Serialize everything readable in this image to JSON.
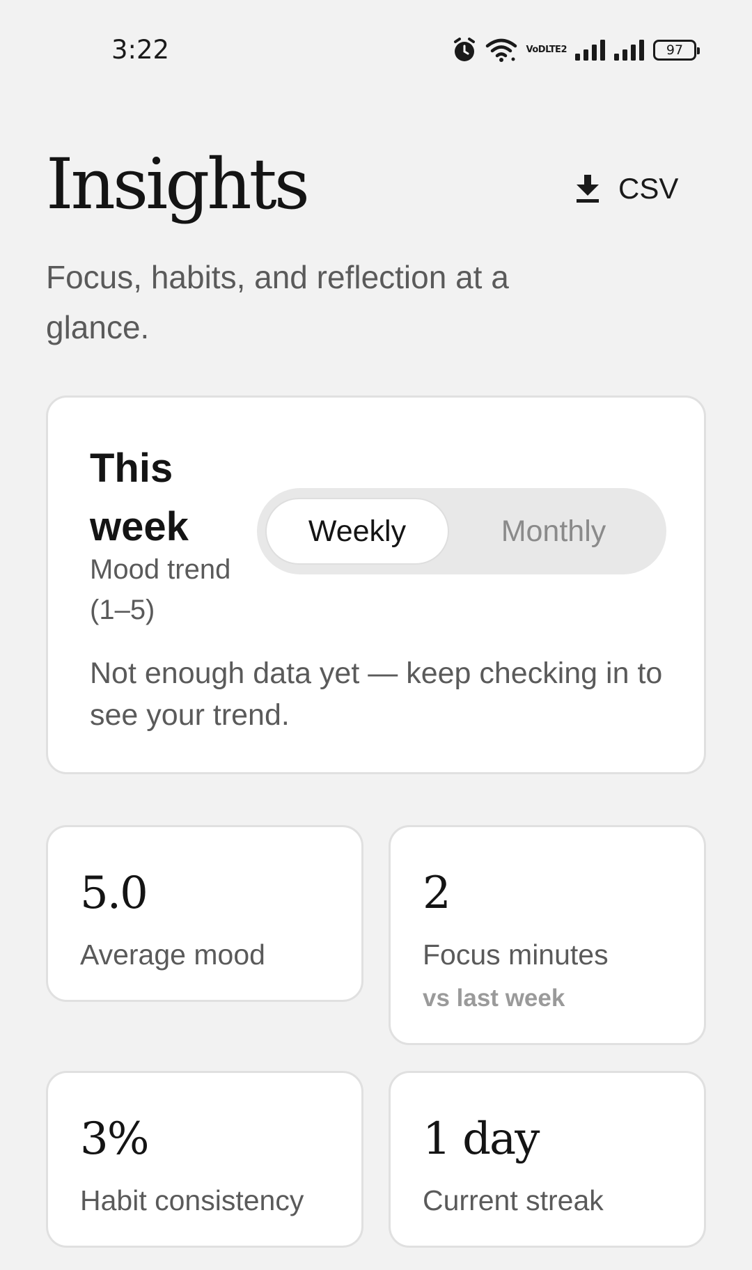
{
  "status_bar": {
    "time": "3:22",
    "battery": "97",
    "volte_top": "VoD",
    "volte_bottom": "LTE2",
    "icons": [
      "alarm-icon",
      "wifi-icon",
      "volte-icon",
      "signal-icon",
      "signal-icon",
      "battery-icon"
    ]
  },
  "header": {
    "title": "Insights",
    "subtitle": "Focus, habits, and reflection at a glance.",
    "export": {
      "icon": "download-icon",
      "label": "CSV"
    }
  },
  "mood_card": {
    "title": "This week",
    "subtitle": "Mood trend (1–5)",
    "toggle": {
      "options": [
        "Weekly",
        "Monthly"
      ],
      "selected": "Weekly"
    },
    "empty_message": "Not enough data yet — keep checking in to see your trend."
  },
  "stats": [
    {
      "value": "5.0",
      "label": "Average mood"
    },
    {
      "value": "2",
      "label": "Focus minutes",
      "sub": "vs last week"
    },
    {
      "value": "3%",
      "label": "Habit consistency"
    },
    {
      "value": "1 day",
      "label": "Current streak"
    }
  ],
  "colors": {
    "background": "#f2f2f2",
    "card": "#ffffff",
    "text_primary": "#141414",
    "text_secondary": "#5a5a5a",
    "text_muted": "#9a9a9a",
    "toggle_track": "#e8e8e8"
  }
}
